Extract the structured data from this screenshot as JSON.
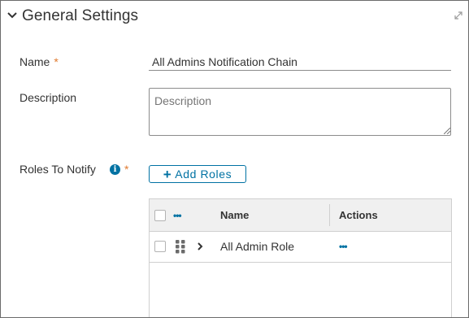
{
  "panel": {
    "title": "General Settings"
  },
  "form": {
    "name_label": "Name",
    "required_mark": "*",
    "name_value": "All Admins Notification Chain",
    "description_label": "Description",
    "description_placeholder": "Description",
    "roles_label": "Roles To Notify",
    "info_icon_glyph": "i",
    "add_roles_plus": "+",
    "add_roles_label": "Add Roles"
  },
  "grid": {
    "actions_glyph": "•••",
    "columns": [
      "Name",
      "Actions"
    ],
    "rows": [
      {
        "name": "All Admin Role",
        "actions_glyph": "•••"
      }
    ]
  },
  "colors": {
    "accent": "#0072a3",
    "required": "#e07a2f",
    "header_bg": "#f0f0f0",
    "border": "#cfcfcf"
  },
  "icons": [
    "chevron-down-icon",
    "expand-icon",
    "info-icon",
    "plus-icon",
    "more-actions-icon",
    "drag-handle-icon",
    "chevron-right-icon",
    "resize-grip-icon"
  ]
}
